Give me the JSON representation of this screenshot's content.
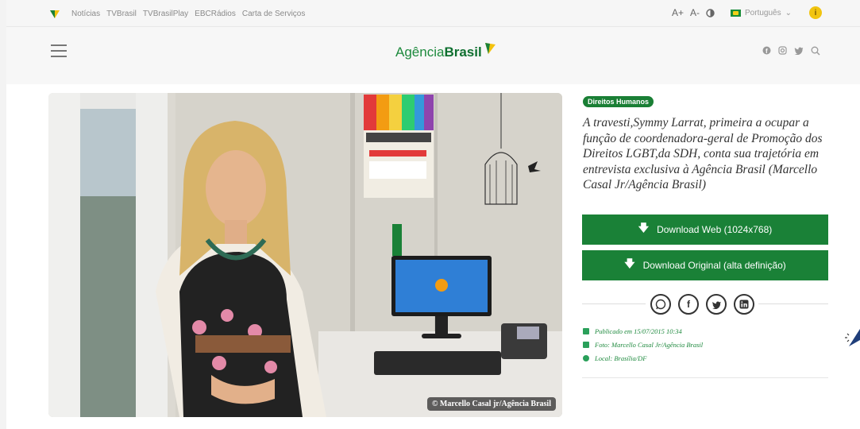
{
  "topbar": {
    "links": [
      "Notícias",
      "TVBrasil",
      "TVBrasilPlay",
      "EBCRádios",
      "Carta de Serviços"
    ],
    "font_increase": "A+",
    "font_decrease": "A-",
    "contrast_icon": "contrast-icon",
    "language": "Português",
    "accessibility_icon": "accessibility-icon"
  },
  "header": {
    "brand_light": "Agência",
    "brand_bold": "Brasil",
    "social_icons": [
      "facebook-icon",
      "instagram-icon",
      "twitter-icon",
      "search-icon"
    ]
  },
  "photo": {
    "credit": "© Marcello Casal jr/Agência Brasil"
  },
  "article": {
    "category": "Direitos Humanos",
    "caption": "A travesti,Symmy Larrat, primeira a ocupar a função de coordenadora-geral de Promoção dos Direitos LGBT,da SDH, conta sua trajetória em entrevista exclusiva à Agência Brasil (Marcello Casal Jr/Agência Brasil)",
    "download_web": "Download Web (1024x768)",
    "download_original": "Download Original (alta definição)",
    "share_icons": [
      "whatsapp-icon",
      "facebook-icon",
      "twitter-icon",
      "linkedin-icon"
    ],
    "published": "Publicado em 15/07/2015 10:34",
    "photo_by": "Foto: Marcello Casal Jr/Agência Brasil",
    "location": "Local: Brasília/DF"
  },
  "colors": {
    "brand_green": "#1a8137",
    "accent_yellow": "#f1c40f"
  }
}
